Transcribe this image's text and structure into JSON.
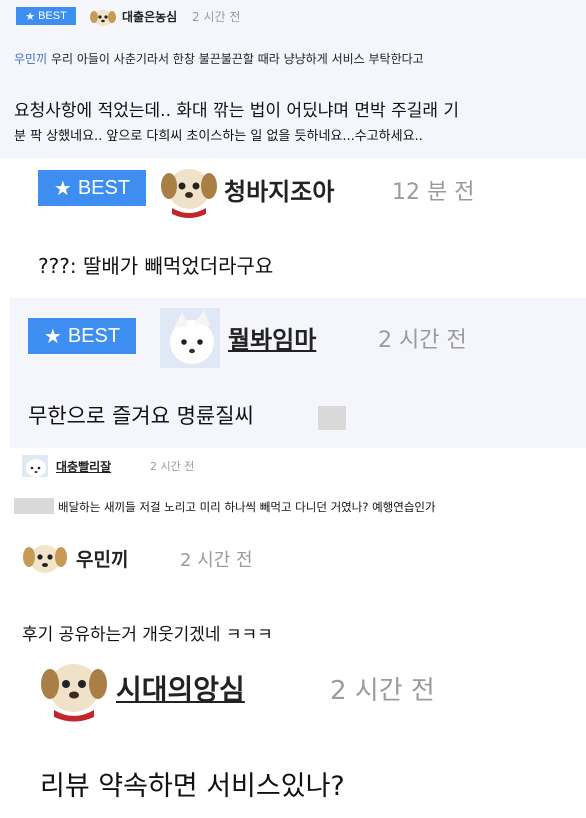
{
  "comments": [
    {
      "badge": "BEST",
      "nickname": "대출은농심",
      "time": "2 시간 전",
      "mention": "우민끼",
      "lines": [
        "우리 아들이 사춘기라서 한창 불끈불끈할 때라 냥냥하게 서비스 부탁한다고",
        "요청사항에 적었는데.. 화대 깎는 법이 어딨냐며 면박 주길래 기",
        "분 팍 상했네요.. 앞으로 다희씨 초이스하는 일 없을 듯하네요...수고하세요.."
      ]
    },
    {
      "badge": "BEST",
      "nickname": "청바지조아",
      "time": "12 분 전",
      "lines": [
        "???: 딸배가 빼먹었더라구요"
      ]
    },
    {
      "badge": "BEST",
      "nickname": "뭘봐임마",
      "time": "2 시간 전",
      "lines": [
        "무한으로 즐겨요 명륜질씨"
      ]
    },
    {
      "nickname": "대충빨리잘",
      "time": "2 시간 전",
      "lines": [
        "배달하는 새끼들 저걸 노리고 미리 하나씩 빼먹고 다니던 거였나? 예행연습인가"
      ]
    },
    {
      "nickname": "우민끼",
      "time": "2 시간 전",
      "lines": [
        "후기 공유하는거 개웃기겠네 ㅋㅋㅋ"
      ]
    },
    {
      "nickname": "시대의앙심",
      "time": "2 시간 전",
      "lines": [
        "리뷰 약속하면 서비스있나?"
      ]
    }
  ],
  "icons": {
    "star": "star-icon",
    "dog": "dog-avatar-icon",
    "dog_red": "dog-red-collar-avatar-icon",
    "white_dog": "white-dog-avatar-icon"
  },
  "colors": {
    "badge_blue": "#3d8ef0",
    "panel_tint": "#f4f6fc",
    "link_blue": "#3f6fd0",
    "time_gray": "#9b9b9b"
  }
}
